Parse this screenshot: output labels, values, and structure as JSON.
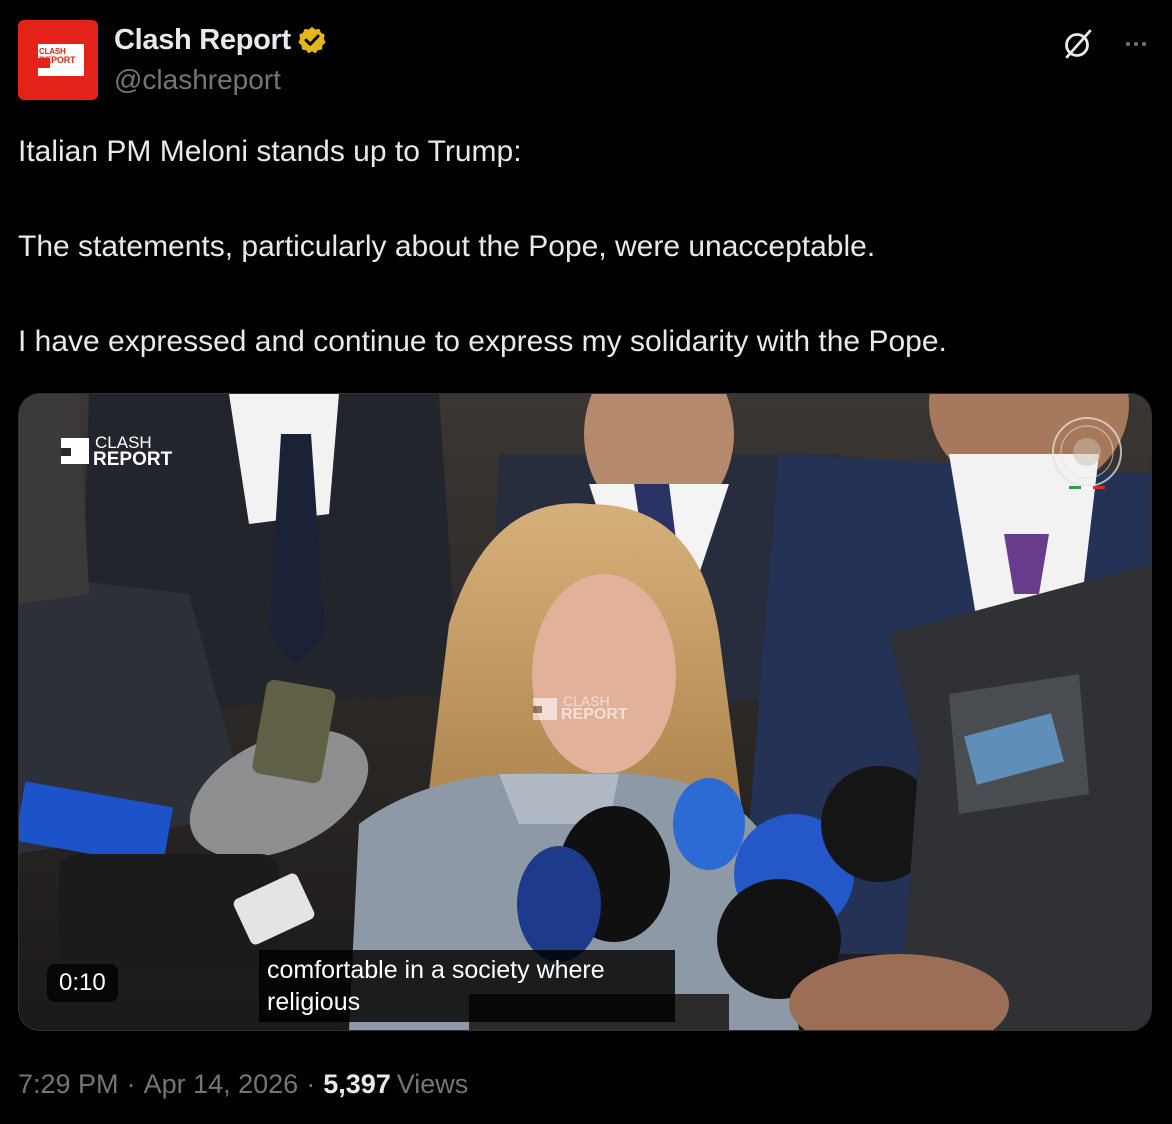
{
  "author": {
    "display_name": "Clash Report",
    "handle": "@clashreport",
    "avatar_text_line1": "CLASH",
    "avatar_text_line2": "REPORT",
    "avatar_color": "#e32219",
    "verified_badge_color": "#e2b719"
  },
  "toolbar": {
    "grok_icon": "grok-icon",
    "more_icon": "more-icon"
  },
  "tweet": {
    "paragraphs": [
      "Italian PM Meloni stands up to Trump:",
      "The statements, particularly about the Pope, were unacceptable.",
      "I have expressed and continue to express my solidarity with the Pope."
    ]
  },
  "media": {
    "watermark_line1": "CLASH",
    "watermark_line2": "REPORT",
    "subtitle": "comfortable in a society where\nreligious",
    "duration": "0:10"
  },
  "meta": {
    "time": "7:29 PM",
    "separator": "·",
    "date": "Apr 14, 2026",
    "views_count": "5,397",
    "views_label": "Views"
  },
  "colors": {
    "background": "#000000",
    "text_primary": "#e7e9ea",
    "text_secondary": "#71767b"
  }
}
